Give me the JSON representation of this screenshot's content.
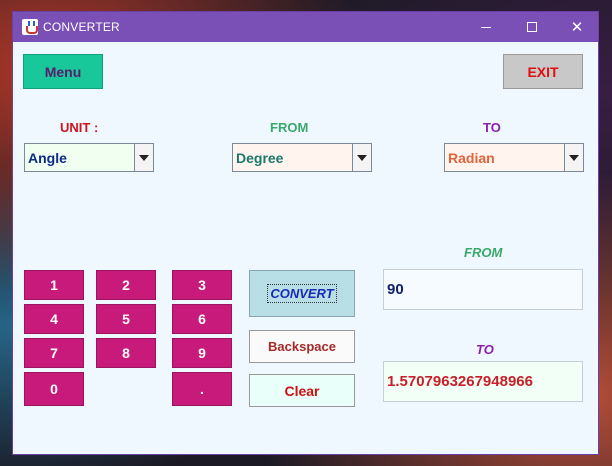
{
  "window": {
    "title": "CONVERTER",
    "icon": "java-cup-icon"
  },
  "controls": {
    "minimize": "minimize-icon",
    "maximize": "maximize-icon",
    "close_glyph": "✕"
  },
  "buttons": {
    "menu": "Menu",
    "exit": "EXIT",
    "convert": "CONVERT",
    "backspace": "Backspace",
    "clear": "Clear"
  },
  "labels": {
    "unit": "UNIT :",
    "from": "FROM",
    "to": "TO"
  },
  "selects": {
    "unit": "Angle",
    "from": "Degree",
    "to": "Radian"
  },
  "keypad": {
    "k1": "1",
    "k2": "2",
    "k3": "3",
    "k4": "4",
    "k5": "5",
    "k6": "6",
    "k7": "7",
    "k8": "8",
    "k9": "9",
    "k0": "0",
    "kdot": "."
  },
  "io": {
    "from_label": "FROM",
    "to_label": "TO",
    "from_value": "90",
    "to_value": "1.5707963267948966"
  },
  "colors": {
    "titlebar": "#7a4fb6",
    "window_bg": "#f0f8ff",
    "key_bg": "#c81a7a",
    "menu_bg": "#18c79a",
    "exit_bg": "#c8c8c8",
    "convert_bg": "#b8dfe6"
  }
}
